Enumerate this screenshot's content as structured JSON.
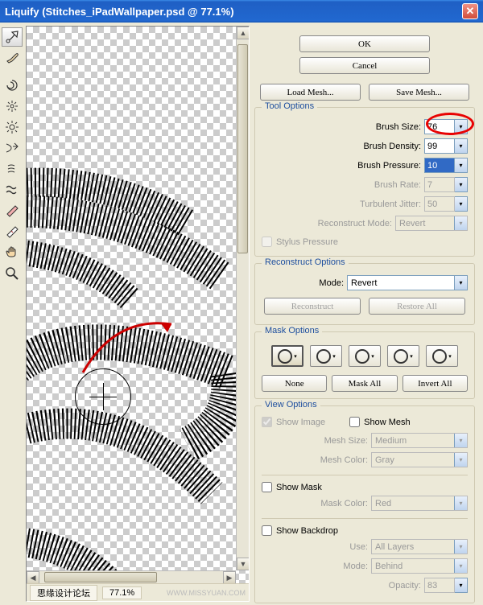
{
  "window": {
    "title": "Liquify (Stitches_iPadWallpaper.psd @ 77.1%)"
  },
  "status": {
    "label_left": "思缘设计论坛",
    "zoom": "77.1%",
    "watermark": "WWW.MISSYUAN.COM"
  },
  "buttons": {
    "ok": "OK",
    "cancel": "Cancel",
    "load_mesh": "Load Mesh...",
    "save_mesh": "Save Mesh..."
  },
  "tool_options": {
    "legend": "Tool Options",
    "brush_size_label": "Brush Size:",
    "brush_size": "76",
    "brush_density_label": "Brush Density:",
    "brush_density": "99",
    "brush_pressure_label": "Brush Pressure:",
    "brush_pressure": "10",
    "brush_rate_label": "Brush Rate:",
    "brush_rate": "7",
    "turbulent_jitter_label": "Turbulent Jitter:",
    "turbulent_jitter": "50",
    "reconstruct_mode_label": "Reconstruct Mode:",
    "reconstruct_mode": "Revert",
    "stylus_pressure": "Stylus Pressure"
  },
  "reconstruct_options": {
    "legend": "Reconstruct Options",
    "mode_label": "Mode:",
    "mode": "Revert",
    "reconstruct": "Reconstruct",
    "restore_all": "Restore All"
  },
  "mask_options": {
    "legend": "Mask Options",
    "none": "None",
    "mask_all": "Mask All",
    "invert_all": "Invert All"
  },
  "view_options": {
    "legend": "View Options",
    "show_image": "Show Image",
    "show_mesh": "Show Mesh",
    "mesh_size_label": "Mesh Size:",
    "mesh_size": "Medium",
    "mesh_color_label": "Mesh Color:",
    "mesh_color": "Gray",
    "show_mask": "Show Mask",
    "mask_color_label": "Mask Color:",
    "mask_color": "Red",
    "show_backdrop": "Show Backdrop",
    "use_label": "Use:",
    "use": "All Layers",
    "mode_label": "Mode:",
    "mode": "Behind",
    "opacity_label": "Opacity:",
    "opacity": "83"
  }
}
